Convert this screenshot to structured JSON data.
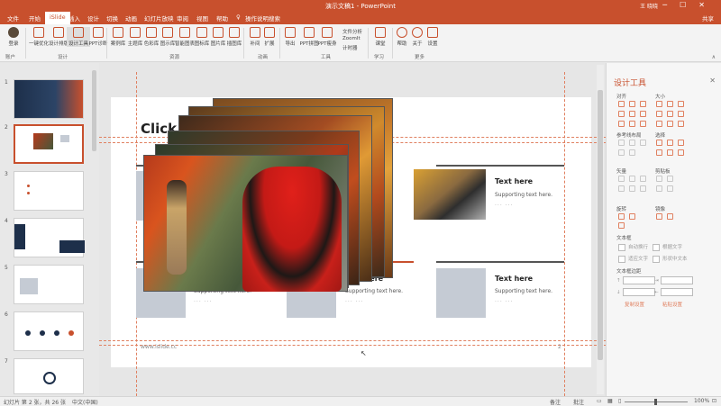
{
  "window": {
    "title": "演示文稿1 - PowerPoint",
    "user": "王 晓晓"
  },
  "tabs": [
    "文件",
    "开始",
    "iSlide",
    "插入",
    "设计",
    "切换",
    "动画",
    "幻灯片放映",
    "审阅",
    "视图",
    "帮助",
    "操作说明搜索"
  ],
  "share_label": "共享",
  "ribbon": {
    "buttons": [
      "登录",
      "一键优化",
      "设计排版",
      "设计工具",
      "PPT诊断",
      "案例库",
      "主题库",
      "色彩库",
      "图示库",
      "智能图表",
      "图标库",
      "图片库",
      "插图库",
      "补间",
      "扩展",
      "导出",
      "PPT拼图",
      "PPT瘦身",
      "课堂",
      "帮助",
      "关于",
      "设置"
    ],
    "small_items": [
      "文件分析",
      "ZoomIt",
      "计时器"
    ],
    "groups": [
      "账户",
      "设计",
      "资源",
      "动画",
      "工具",
      "学习",
      "更多"
    ]
  },
  "thumbnails": {
    "numbers": [
      "1",
      "2",
      "3",
      "4",
      "5",
      "6",
      "7"
    ]
  },
  "slide": {
    "title": "Click",
    "cards": [
      {
        "head": "Text here",
        "sub": "Supporting text here."
      },
      {
        "head": "Text here",
        "sub": "Supporting text here."
      },
      {
        "head": "Text here",
        "sub": "Supporting text here."
      },
      {
        "head": "Text here",
        "sub": "Supporting text here."
      }
    ],
    "footer_url": "www.islide.cc",
    "page_num": "2",
    "dots": "...  ..."
  },
  "panel": {
    "title": "设计工具",
    "sections": [
      "对齐",
      "大小",
      "参考线布局",
      "选择",
      "矢量",
      "剪贴板",
      "旋转",
      "镜像",
      "文本框",
      "文本框边距"
    ],
    "checkboxes": [
      "自动换行",
      "根据文字",
      "适应文字",
      "形状中文本"
    ],
    "links": [
      "复制设置",
      "粘贴设置"
    ]
  },
  "status": {
    "slide_info": "幻灯片 第 2 张，共 26 张",
    "language": "中文(中国)",
    "notes": "备注",
    "comments": "批注",
    "zoom": "100%"
  }
}
